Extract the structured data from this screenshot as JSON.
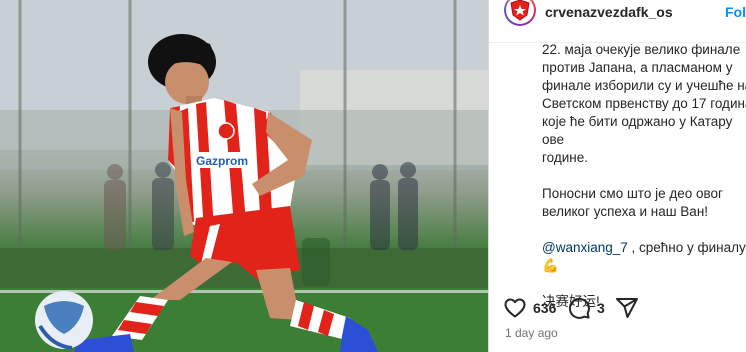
{
  "post": {
    "username": "crvenazvezdafk_os",
    "follow_label": "Follo",
    "caption": {
      "paragraph_1": "22. маја очекује велико финале\nпротив Јапана, а пласманом у\nфинале изборили су и учешће на\nСветском првенству до 17 година\nкоје ће бити одржано у Катару ове\nгодине.",
      "paragraph_2": "Поносни смо што је део овог\nвеликог успеха и наш Ван!",
      "mention": "@wanxiang_7",
      "mention_rest": " , срећно у финалу! ",
      "emoji": "💪",
      "paragraph_4": "决赛好运!"
    },
    "likes": "636",
    "comments": "3",
    "timestamp": "1 day ago",
    "icons": {
      "like": "heart-icon",
      "comment": "comment-icon",
      "share": "share-icon",
      "avatar": "club-crest-icon"
    },
    "photo": {
      "jersey_text": "Gazprom",
      "kit_colors": [
        "#e2231a",
        "#ffffff"
      ],
      "pitch_color": "#2f6b2c"
    }
  }
}
